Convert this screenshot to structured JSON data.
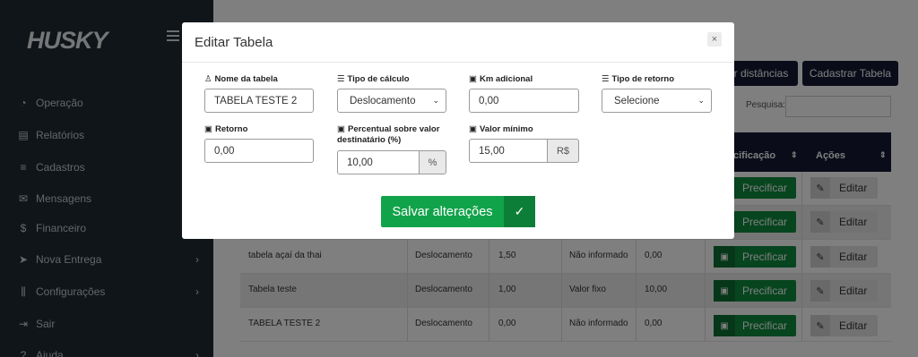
{
  "sidebar": {
    "logo": "HUSKY",
    "items": [
      {
        "label": "Operação",
        "icon": "dashboard-icon",
        "glyph": "◔"
      },
      {
        "label": "Relatórios",
        "icon": "report-icon",
        "glyph": "▤"
      },
      {
        "label": "Cadastros",
        "icon": "list-plus-icon",
        "glyph": "≡"
      },
      {
        "label": "Mensagens",
        "icon": "envelope-icon",
        "glyph": "✉"
      },
      {
        "label": "Financeiro",
        "icon": "dollar-icon",
        "glyph": "$"
      },
      {
        "label": "Nova Entrega",
        "icon": "paper-plane-icon",
        "glyph": "➤"
      },
      {
        "label": "Configurações",
        "icon": "sliders-icon",
        "glyph": "⫼"
      },
      {
        "label": "Sair",
        "icon": "sign-out-icon",
        "glyph": "⇥"
      },
      {
        "label": "Ajuda",
        "icon": "help-icon",
        "glyph": "?"
      }
    ]
  },
  "page": {
    "buttons": {
      "distancias": "r distâncias",
      "cadastrar": "Cadastrar Tabela"
    },
    "search_label": "Pesquisa:",
    "table": {
      "headers": {
        "precificacao": "cificação",
        "acoes": "Ações"
      },
      "rows": [
        {
          "nome": "",
          "tipo": "",
          "km": "",
          "retorno": "",
          "valor": ""
        },
        {
          "nome": "",
          "tipo": "",
          "km": "",
          "retorno": "",
          "valor": ""
        },
        {
          "nome": "tabela açaí da thai",
          "tipo": "Deslocamento",
          "km": "1,50",
          "retorno": "Não informado",
          "valor": "0,00"
        },
        {
          "nome": "Tabela teste",
          "tipo": "Deslocamento",
          "km": "1,00",
          "retorno": "Valor fixo",
          "valor": "10,00"
        },
        {
          "nome": "TABELA TESTE 2",
          "tipo": "Deslocamento",
          "km": "0,00",
          "retorno": "Não informado",
          "valor": "0,00"
        }
      ],
      "precificar_label": "Precificar",
      "editar_label": "Editar"
    }
  },
  "modal": {
    "title": "Editar Tabela",
    "close": "×",
    "fields": {
      "nome_tabela": {
        "label": "Nome da tabela",
        "value": "TABELA TESTE 2"
      },
      "tipo_calculo": {
        "label": "Tipo de cálculo",
        "value": "Deslocamento"
      },
      "km_adicional": {
        "label": "Km adicional",
        "value": "0,00"
      },
      "tipo_retorno": {
        "label": "Tipo de retorno",
        "value": "Selecione"
      },
      "retorno": {
        "label": "Retorno",
        "value": "0,00"
      },
      "percentual": {
        "label_line1": "Percentual sobre valor",
        "label_line2": "destinatário (%)",
        "value": "10,00",
        "addon": "%"
      },
      "valor_minimo": {
        "label": "Valor mínimo",
        "value": "15,00",
        "addon": "R$"
      }
    },
    "save_label": "Salvar alterações",
    "save_icon": "✓"
  },
  "colors": {
    "sidebar": "#1f2a33",
    "navy": "#141a33",
    "green": "#11a34a",
    "green_dark": "#0c7e38"
  }
}
